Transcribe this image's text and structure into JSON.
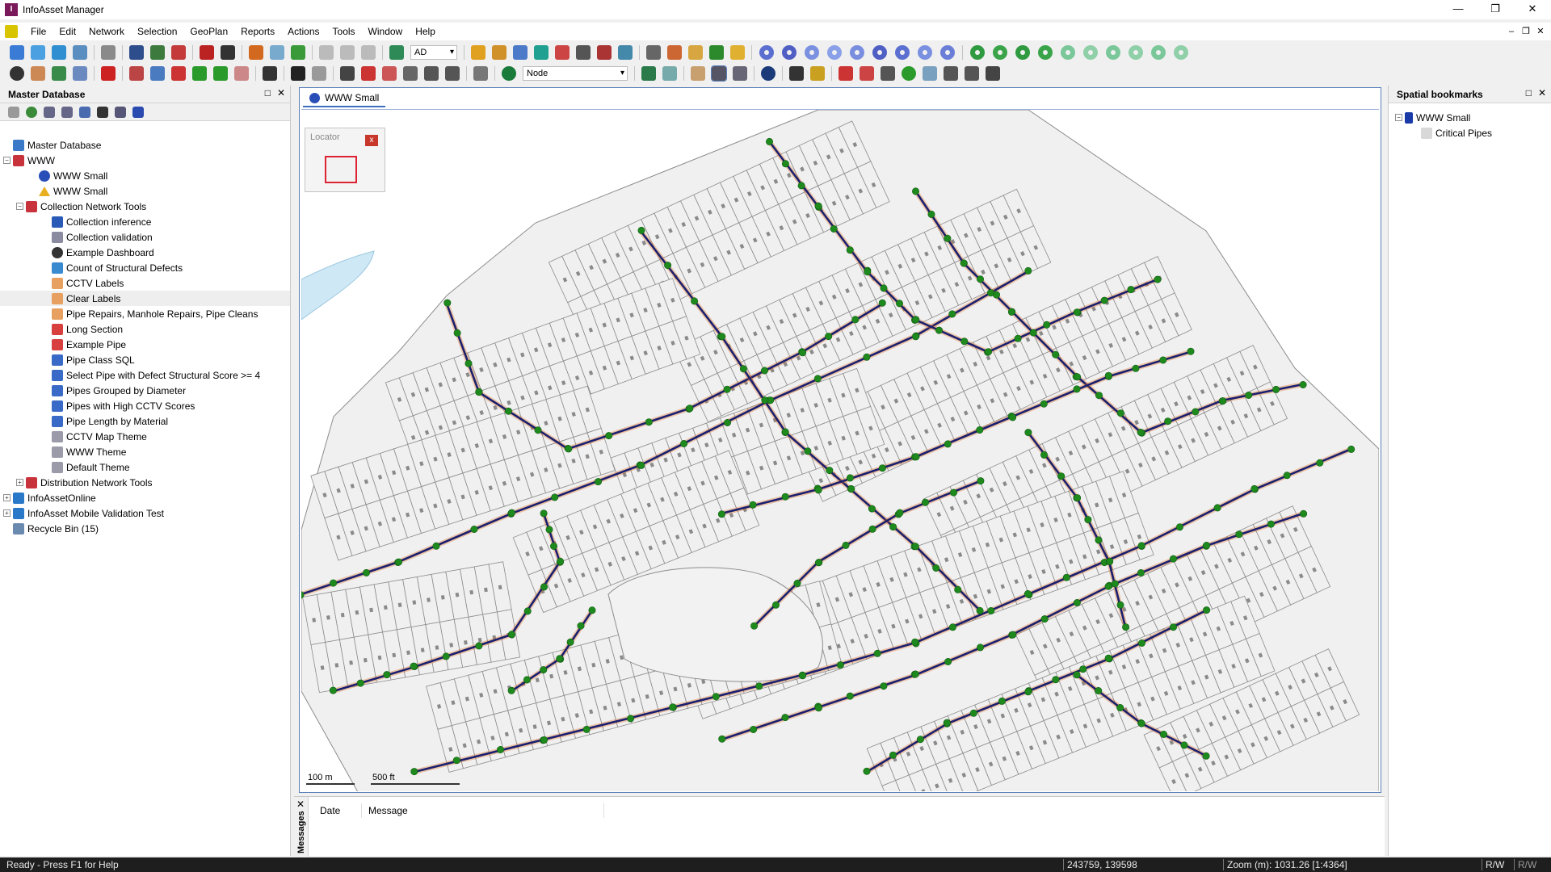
{
  "window": {
    "title": "InfoAsset Manager",
    "controls": [
      "—",
      "❐",
      "✕"
    ]
  },
  "menu": [
    "File",
    "Edit",
    "Network",
    "Selection",
    "GeoPlan",
    "Reports",
    "Actions",
    "Tools",
    "Window",
    "Help"
  ],
  "mdi_controls": [
    "–",
    "❐",
    "✕"
  ],
  "toolbar": {
    "combo1_value": "AD",
    "node_combo_value": "Node"
  },
  "left_panel": {
    "title": "Master Database",
    "tree": [
      {
        "label": "Master Database",
        "indent": 0,
        "expander": "",
        "icon": "db"
      },
      {
        "label": "WWW",
        "indent": 0,
        "expander": "−",
        "icon": "db-red"
      },
      {
        "label": "WWW Small",
        "indent": 2,
        "expander": "",
        "icon": "globe"
      },
      {
        "label": "WWW Small",
        "indent": 2,
        "expander": "",
        "icon": "triangle"
      },
      {
        "label": "Collection Network Tools",
        "indent": 1,
        "expander": "−",
        "icon": "db-red"
      },
      {
        "label": "Collection inference",
        "indent": 3,
        "expander": "",
        "icon": "inference"
      },
      {
        "label": "Collection validation",
        "indent": 3,
        "expander": "",
        "icon": "validation"
      },
      {
        "label": "Example Dashboard",
        "indent": 3,
        "expander": "",
        "icon": "dashboard"
      },
      {
        "label": "Count of Structural Defects",
        "indent": 3,
        "expander": "",
        "icon": "chart"
      },
      {
        "label": "CCTV Labels",
        "indent": 3,
        "expander": "",
        "icon": "label"
      },
      {
        "label": "Clear Labels",
        "indent": 3,
        "expander": "",
        "icon": "label",
        "selected": true
      },
      {
        "label": "Pipe Repairs, Manhole Repairs, Pipe Cleans",
        "indent": 3,
        "expander": "",
        "icon": "label"
      },
      {
        "label": "Long Section",
        "indent": 3,
        "expander": "",
        "icon": "profile"
      },
      {
        "label": "Example Pipe",
        "indent": 3,
        "expander": "",
        "icon": "profile"
      },
      {
        "label": "Pipe Class SQL",
        "indent": 3,
        "expander": "",
        "icon": "sql"
      },
      {
        "label": "Select Pipe with Defect Structural Score >= 4",
        "indent": 3,
        "expander": "",
        "icon": "sql"
      },
      {
        "label": "Pipes Grouped by Diameter",
        "indent": 3,
        "expander": "",
        "icon": "sql"
      },
      {
        "label": "Pipes with High CCTV Scores",
        "indent": 3,
        "expander": "",
        "icon": "sql"
      },
      {
        "label": "Pipe Length by Material",
        "indent": 3,
        "expander": "",
        "icon": "sql"
      },
      {
        "label": "CCTV Map Theme",
        "indent": 3,
        "expander": "",
        "icon": "theme"
      },
      {
        "label": "WWW Theme",
        "indent": 3,
        "expander": "",
        "icon": "theme"
      },
      {
        "label": "Default Theme",
        "indent": 3,
        "expander": "",
        "icon": "theme"
      },
      {
        "label": "Distribution Network Tools",
        "indent": 1,
        "expander": "+",
        "icon": "db-red"
      },
      {
        "label": "InfoAssetOnline",
        "indent": 0,
        "expander": "+",
        "icon": "db-online"
      },
      {
        "label": "InfoAsset Mobile Validation Test",
        "indent": 0,
        "expander": "+",
        "icon": "db-online"
      },
      {
        "label": "Recycle Bin (15)",
        "indent": 0,
        "expander": "",
        "icon": "recycle"
      }
    ]
  },
  "map": {
    "tab_label": "WWW Small",
    "locator_title": "Locator",
    "locator_close": "x",
    "scale_m": "100 m",
    "scale_ft": "500 ft"
  },
  "right_panel": {
    "title": "Spatial bookmarks",
    "items": [
      {
        "label": "WWW Small",
        "indent": 0
      },
      {
        "label": "Critical Pipes",
        "indent": 1
      }
    ]
  },
  "messages": {
    "side_label": "Messages",
    "col_date": "Date",
    "col_message": "Message"
  },
  "status": {
    "ready": "Ready - Press F1 for Help",
    "coords": "243759, 139598",
    "zoom": "Zoom (m): 1031.26 [1:4364]",
    "rw": "R/W",
    "rw2": "R/W"
  },
  "colors": {
    "pipe": "#1a1f6e",
    "pipe_highlight": "#e06a1a",
    "node": "#1e8a1e",
    "parcel_fill": "#f0f0f0",
    "parcel_edge": "#8c8c8c",
    "water": "#cfe8f5"
  }
}
